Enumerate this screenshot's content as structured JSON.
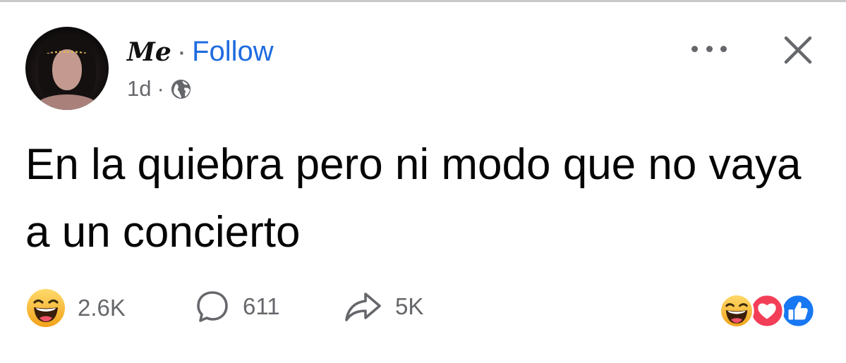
{
  "post": {
    "author_name": "Me",
    "separator": "·",
    "follow_label": "Follow",
    "time_ago": "1d",
    "audience_icon": "globe-icon",
    "text": "En la quiebra pero ni modo que no vaya a un concierto"
  },
  "actions": {
    "more_icon": "more-options-icon",
    "close_icon": "close-icon"
  },
  "stats": {
    "reactions_count": "2.6K",
    "comments_count": "611",
    "shares_count": "5K",
    "reaction_types": [
      "haha",
      "love",
      "like"
    ]
  },
  "colors": {
    "follow": "#1e6be0",
    "secondary_text": "#65676b",
    "love": "#f33e58",
    "like": "#1877f2",
    "haha": "#f7b125"
  }
}
